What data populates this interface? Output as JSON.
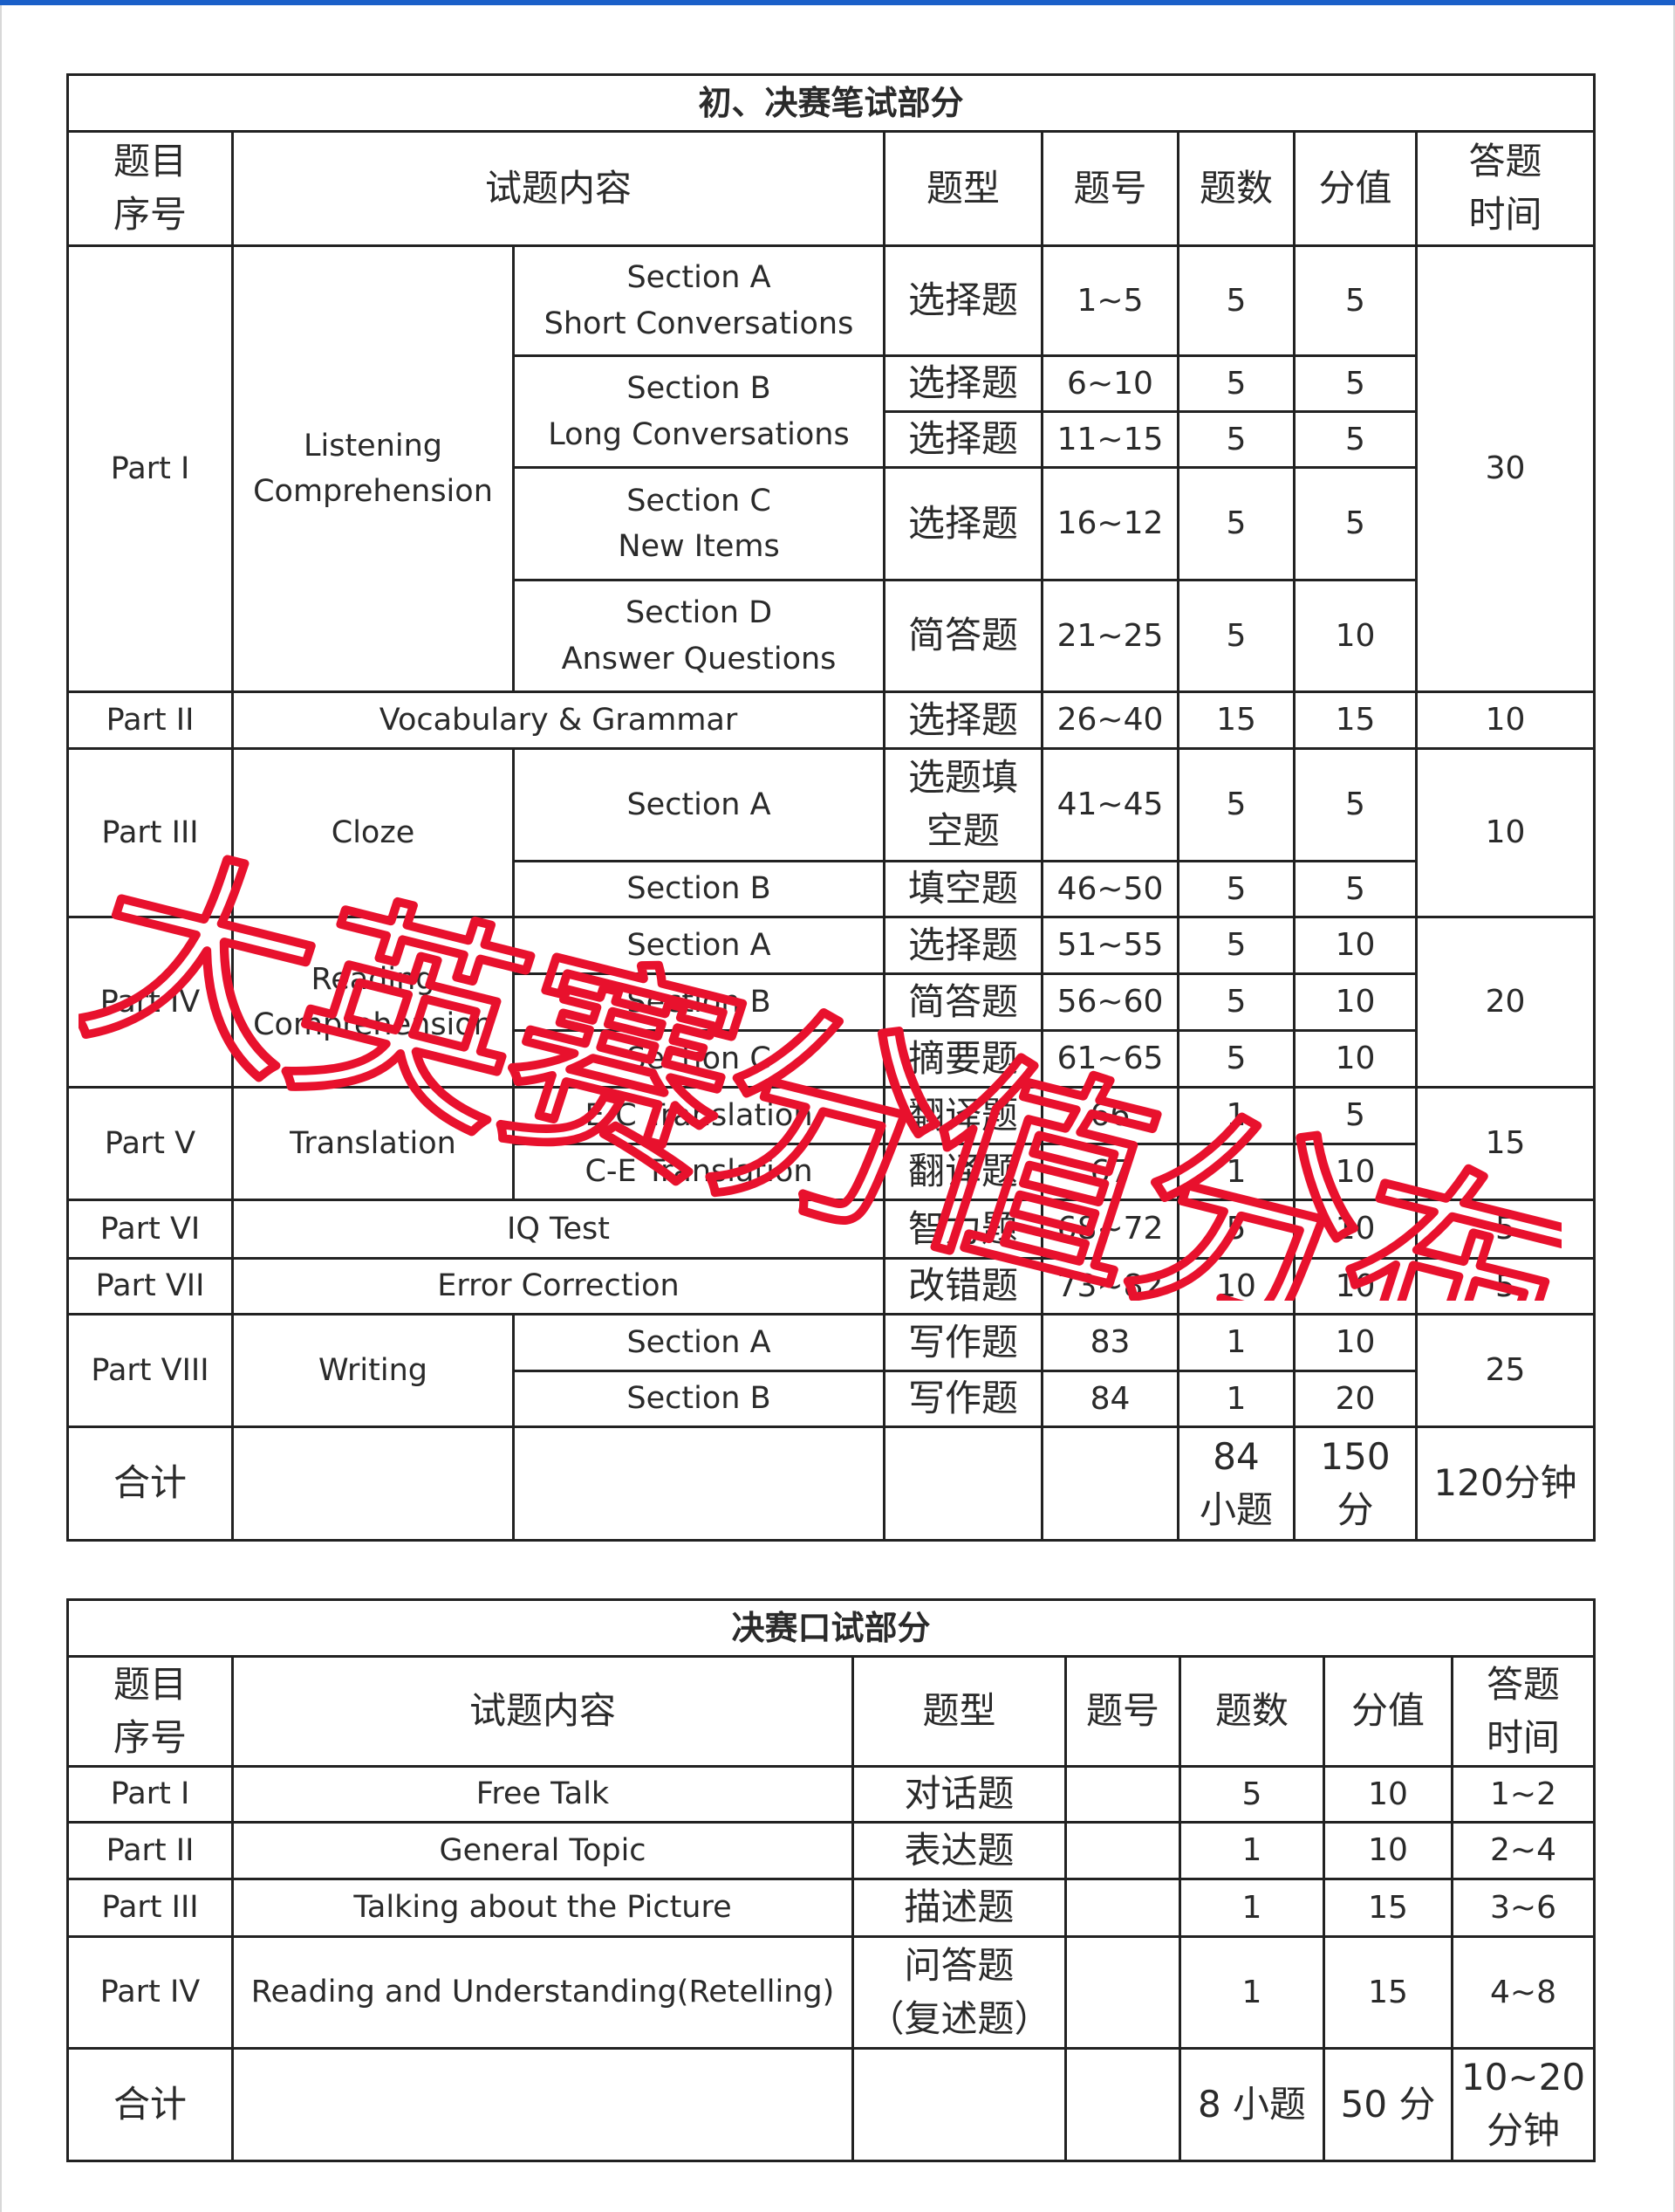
{
  "written_table": {
    "title": "初、决赛笔试部分",
    "headers": {
      "part_no": [
        "题目",
        "序号"
      ],
      "content": "试题内容",
      "type": "题型",
      "question_no": "题号",
      "count": "题数",
      "score": "分值",
      "time": [
        "答题",
        "时间"
      ]
    },
    "rows": [
      {
        "part": "Part I",
        "content": [
          "Listening",
          "Comprehension"
        ],
        "time": "30",
        "sections": [
          {
            "section": [
              "Section A",
              "Short Conversations"
            ],
            "items": [
              {
                "type": "选择题",
                "no": "1~5",
                "count": "5",
                "score": "5"
              }
            ]
          },
          {
            "section": [
              "Section B",
              "Long Conversations"
            ],
            "items": [
              {
                "type": "选择题",
                "no": "6~10",
                "count": "5",
                "score": "5"
              },
              {
                "type": "选择题",
                "no": "11~15",
                "count": "5",
                "score": "5"
              }
            ]
          },
          {
            "section": [
              "Section C",
              "New Items"
            ],
            "items": [
              {
                "type": "选择题",
                "no": "16~12",
                "count": "5",
                "score": "5"
              }
            ]
          },
          {
            "section": [
              "Section D",
              "Answer Questions"
            ],
            "items": [
              {
                "type": "简答题",
                "no": "21~25",
                "count": "5",
                "score": "10"
              }
            ]
          }
        ]
      },
      {
        "part": "Part II",
        "content": "Vocabulary & Grammar",
        "type": "选择题",
        "no": "26~40",
        "count": "15",
        "score": "15",
        "time": "10"
      },
      {
        "part": "Part III",
        "content": "Cloze",
        "time": "10",
        "sections": [
          {
            "section": "Section A",
            "type": [
              "选题填",
              "空题"
            ],
            "no": "41~45",
            "count": "5",
            "score": "5"
          },
          {
            "section": "Section B",
            "type": "填空题",
            "no": "46~50",
            "count": "5",
            "score": "5"
          }
        ]
      },
      {
        "part": "Part IV",
        "content": [
          "Reading",
          "Comprehension"
        ],
        "time": "20",
        "sections": [
          {
            "section": "Section A",
            "type": "选择题",
            "no": "51~55",
            "count": "5",
            "score": "10"
          },
          {
            "section": "Section B",
            "type": "简答题",
            "no": "56~60",
            "count": "5",
            "score": "10"
          },
          {
            "section": "Section C",
            "type": "摘要题",
            "no": "61~65",
            "count": "5",
            "score": "10"
          }
        ]
      },
      {
        "part": "Part V",
        "content": "Translation",
        "time": "15",
        "sections": [
          {
            "section": "E-C Translation",
            "type": "翻译题",
            "no": "66",
            "count": "1",
            "score": "5"
          },
          {
            "section": "C-E Translation",
            "type": "翻译题",
            "no": "67",
            "count": "1",
            "score": "10"
          }
        ]
      },
      {
        "part": "Part VI",
        "content": "IQ Test",
        "type": "智力题",
        "no": "68~72",
        "count": "5",
        "score": "10",
        "time": "5"
      },
      {
        "part": "Part VII",
        "content": "Error Correction",
        "type": "改错题",
        "no": "73~82",
        "count": "10",
        "score": "10",
        "time": "5"
      },
      {
        "part": "Part VIII",
        "content": "Writing",
        "time": "25",
        "sections": [
          {
            "section": "Section A",
            "type": "写作题",
            "no": "83",
            "count": "1",
            "score": "10"
          },
          {
            "section": "Section B",
            "type": "写作题",
            "no": "84",
            "count": "1",
            "score": "20"
          }
        ]
      }
    ],
    "total": {
      "label": "合计",
      "count": [
        "84",
        "小题"
      ],
      "score": [
        "150",
        "分"
      ],
      "time": "120分钟"
    }
  },
  "oral_table": {
    "title": "决赛口试部分",
    "headers": {
      "part_no": [
        "题目",
        "序号"
      ],
      "content": "试题内容",
      "type": "题型",
      "question_no": "题号",
      "count": "题数",
      "score": "分值",
      "time": [
        "答题",
        "时间"
      ]
    },
    "rows": [
      {
        "part": "Part I",
        "content": "Free Talk",
        "type": "对话题",
        "no": "",
        "count": "5",
        "score": "10",
        "time": "1~2"
      },
      {
        "part": "Part II",
        "content": "General Topic",
        "type": "表达题",
        "no": "",
        "count": "1",
        "score": "10",
        "time": "2~4"
      },
      {
        "part": "Part III",
        "content": "Talking about the Picture",
        "type": "描述题",
        "no": "",
        "count": "1",
        "score": "15",
        "time": "3~6"
      },
      {
        "part": "Part IV",
        "content": "Reading and Understanding(Retelling)",
        "type": [
          "问答题",
          "（复述题）"
        ],
        "no": "",
        "count": "1",
        "score": "15",
        "time": "4~8"
      }
    ],
    "total": {
      "label": "合计",
      "count": "8 小题",
      "score": "50 分",
      "time": [
        "10~20",
        "分钟"
      ]
    }
  },
  "watermark": {
    "text": "大英赛分值分布",
    "color": "#e8112d"
  },
  "colors": {
    "top_bar": "#1a5fc8",
    "border": "#222222"
  }
}
